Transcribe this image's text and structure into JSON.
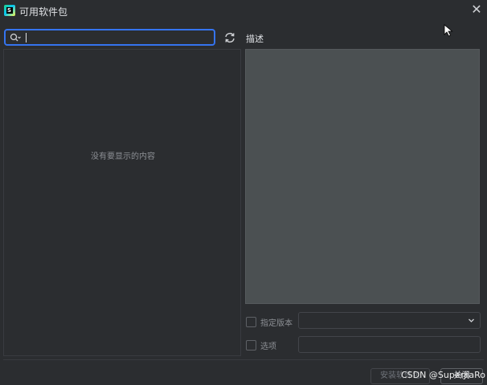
{
  "window": {
    "title": "可用软件包",
    "close_glyph": "✕"
  },
  "search": {
    "value": "",
    "placeholder": "",
    "icon": "search-icon"
  },
  "refresh": {
    "icon": "refresh-icon"
  },
  "package_list": {
    "empty_text": "没有要显示的内容"
  },
  "description": {
    "label": "描述"
  },
  "specify_version": {
    "label": "指定版本",
    "selected": ""
  },
  "options": {
    "label": "选项",
    "value": ""
  },
  "buttons": {
    "install": "安装软件包",
    "close": "关闭"
  },
  "watermark": "CSDN @SuperJiaRo",
  "colors": {
    "accent": "#3574f0",
    "background": "#2b2d30",
    "description_bg": "#4b5052"
  }
}
